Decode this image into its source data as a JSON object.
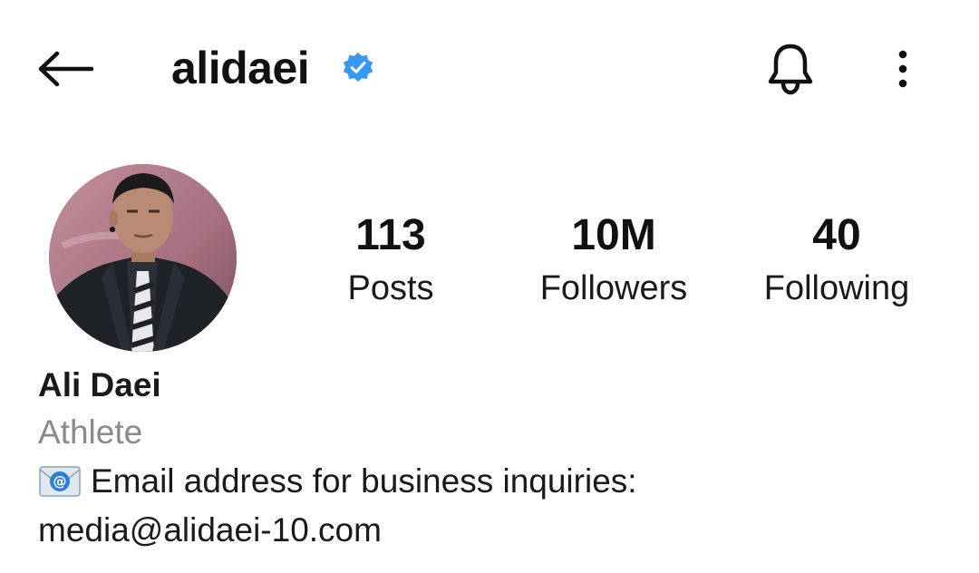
{
  "header": {
    "username": "alidaei",
    "verified_badge_color": "#3897f0",
    "icons": [
      "back-arrow-icon",
      "verified-badge-icon",
      "bell-icon",
      "more-vertical-icon"
    ]
  },
  "profile": {
    "stats": [
      {
        "value": "113",
        "label": "Posts"
      },
      {
        "value": "10M",
        "label": "Followers"
      },
      {
        "value": "40",
        "label": "Following"
      }
    ],
    "full_name": "Ali Daei",
    "category": "Athlete",
    "bio": {
      "line1": "Email address for business inquiries:",
      "line2": "media@alidaei-10.com"
    }
  }
}
